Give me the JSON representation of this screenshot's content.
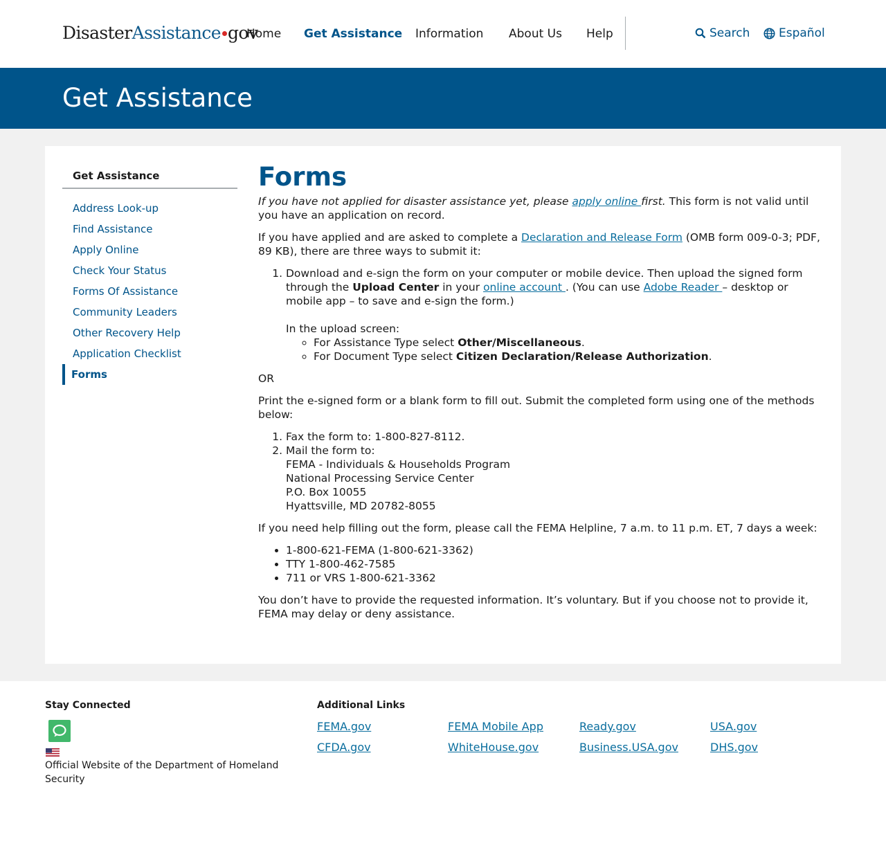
{
  "header": {
    "logo": {
      "part1": "Disaster",
      "part2": "Assistance",
      "part3": "gov"
    },
    "nav": [
      "Home",
      "Get Assistance",
      "Information",
      "About Us",
      "Help"
    ],
    "search_label": "Search",
    "language_label": "Español"
  },
  "banner": {
    "title": "Get Assistance"
  },
  "sidebar": {
    "heading": "Get Assistance",
    "items": [
      "Address Look-up",
      "Find Assistance",
      "Apply Online",
      "Check Your Status",
      "Forms Of Assistance",
      "Community Leaders",
      "Other Recovery Help",
      "Application Checklist",
      "Forms"
    ]
  },
  "main": {
    "title": "Forms",
    "intro_italic_1": "If you have not applied for disaster assistance yet, please ",
    "intro_link": "apply online ",
    "intro_italic_2": "first.",
    "intro_rest": " This form is not valid until you have an application on record.",
    "p2_a": "If you have applied and are asked to complete a ",
    "p2_link": "Declaration and Release Form",
    "p2_b": " (OMB form 009-0-3; PDF, 89 KB), there are three ways to submit it:",
    "step1_a": "Download and e-sign the form on your computer or mobile device. Then upload the signed form through the ",
    "step1_bold": "Upload Center",
    "step1_b": " in your ",
    "step1_link1": "online account ",
    "step1_c": ". (You can use ",
    "step1_link2": "Adobe Reader ",
    "step1_d": "– desktop or mobile app – to save and e-sign the form.)",
    "upload_screen": "In the upload screen:",
    "sub1_a": "For Assistance Type select ",
    "sub1_bold": "Other/Miscellaneous",
    "sub2_a": "For Document Type select ",
    "sub2_bold": "Citizen Declaration/Release Authorization",
    "or": "OR",
    "print_text": "Print the e-signed form or a blank form to fill out. Submit the completed form using one of the methods below:",
    "fax": "Fax the form to: 1-800-827-8112.",
    "mail_intro": "Mail the form to:",
    "address": [
      "FEMA - Individuals & Households Program",
      "National Processing Service Center",
      "P.O. Box 10055",
      "Hyattsville, MD 20782-8055"
    ],
    "help_text": "If you need help filling out the form, please call the FEMA Helpline, 7 a.m. to 11 p.m. ET, 7 days a week:",
    "phones": [
      "1-800-621-FEMA (1-800-621-3362)",
      "TTY 1-800-462-7585",
      "711 or VRS 1-800-621-3362"
    ],
    "voluntary": "You don’t have to provide the requested information. It’s voluntary. But if you choose not to provide it, FEMA may delay or deny assistance."
  },
  "footer": {
    "stay_connected": "Stay Connected",
    "official": "Official Website of the Department of Homeland Security",
    "additional_links": "Additional Links",
    "links": [
      "FEMA.gov",
      "FEMA Mobile App",
      "Ready.gov",
      "USA.gov",
      "CFDA.gov",
      "WhiteHouse.gov",
      "Business.USA.gov",
      "DHS.gov"
    ]
  },
  "colors": {
    "primary": "#00548a",
    "link": "#0a6e9e",
    "logo_dot": "#d82a28",
    "chat": "#41b86b",
    "grey_bg": "#f1f1f1"
  },
  "icons": {
    "search": "search-icon",
    "language": "globe-icon",
    "chat": "chat-icon",
    "flag": "us-flag-icon"
  }
}
